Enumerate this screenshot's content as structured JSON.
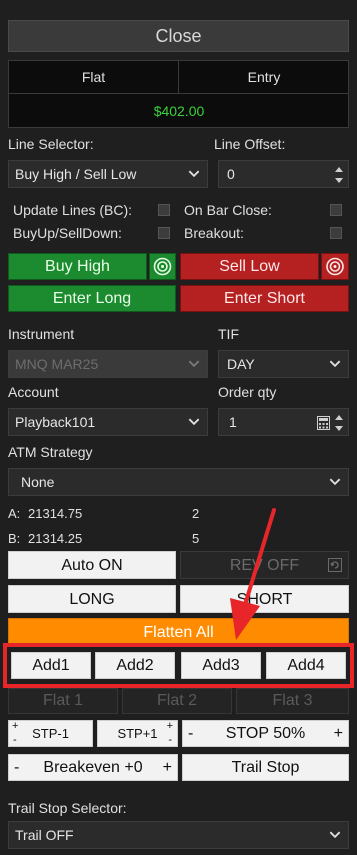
{
  "header": {
    "close_label": "Close"
  },
  "position_table": {
    "col_flat": "Flat",
    "col_entry": "Entry",
    "pnl": "$402.00"
  },
  "lines": {
    "selector_label": "Line Selector:",
    "selector_value": "Buy High / Sell Low",
    "offset_label": "Line Offset:",
    "offset_value": "0",
    "update_lines_label": "Update Lines (BC):",
    "on_bar_close_label": "On Bar Close:",
    "buyup_label": "BuyUp/SellDown:",
    "breakout_label": "Breakout:"
  },
  "actions": {
    "buy_high": "Buy High",
    "sell_low": "Sell Low",
    "enter_long": "Enter Long",
    "enter_short": "Enter Short"
  },
  "order": {
    "instrument_label": "Instrument",
    "instrument_value": "MNQ MAR25",
    "tif_label": "TIF",
    "tif_value": "DAY",
    "account_label": "Account",
    "account_value": "Playback101",
    "qty_label": "Order qty",
    "qty_value": "1",
    "atm_label": "ATM Strategy",
    "atm_value": "None"
  },
  "quotes": {
    "ask_label": "A:",
    "ask_price": "21314.75",
    "ask_size": "2",
    "bid_label": "B:",
    "bid_price": "21314.25",
    "bid_size": "5"
  },
  "controls": {
    "auto_on": "Auto ON",
    "rev_off": "REV OFF",
    "long": "LONG",
    "short": "SHORT",
    "flatten_all": "Flatten All",
    "add1": "Add1",
    "add2": "Add2",
    "add3": "Add3",
    "add4": "Add4",
    "flat1": "Flat 1",
    "flat2": "Flat 2",
    "flat3": "Flat 3",
    "stp_minus": "STP-1",
    "stp_plus": "STP+1",
    "stop50": "STOP 50%",
    "breakeven": "Breakeven +0",
    "trail_stop": "Trail Stop",
    "plus": "+",
    "minus": "-"
  },
  "trail": {
    "selector_label": "Trail Stop Selector:",
    "selector_value": "Trail OFF"
  },
  "colors": {
    "accent_orange": "#ff8c00",
    "annotation_red": "#e8262a",
    "pnl_green": "#3cd13c"
  }
}
